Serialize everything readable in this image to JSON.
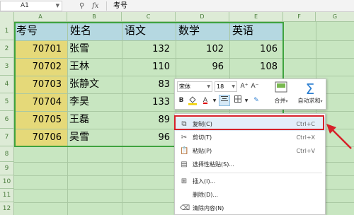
{
  "formula_bar": {
    "cell_ref": "A1",
    "fx_label": "fx",
    "content": "考号"
  },
  "columns": [
    "A",
    "B",
    "C",
    "D",
    "E",
    "F",
    "G"
  ],
  "rows": [
    "1",
    "2",
    "3",
    "4",
    "5",
    "6",
    "7",
    "8",
    "9",
    "10",
    "11",
    "12"
  ],
  "table": {
    "headers": [
      "考号",
      "姓名",
      "语文",
      "数学",
      "英语"
    ],
    "rows": [
      [
        "70701",
        "张雪",
        "132",
        "102",
        "106"
      ],
      [
        "70702",
        "王林",
        "110",
        "96",
        "108"
      ],
      [
        "70703",
        "张静文",
        "83",
        "",
        ""
      ],
      [
        "70704",
        "李昊",
        "133",
        "",
        ""
      ],
      [
        "70705",
        "王磊",
        "89",
        "",
        ""
      ],
      [
        "70706",
        "吴雪",
        "96",
        "",
        ""
      ]
    ]
  },
  "mini_toolbar": {
    "font": "宋体",
    "size": "18",
    "grow": "A⁺",
    "shrink": "A⁻",
    "bold": "B",
    "merge_label": "合并",
    "autosum_label": "自动求和"
  },
  "context_menu": {
    "items": [
      {
        "label": "复制(C)",
        "shortcut": "Ctrl+C",
        "icon": "copy-icon"
      },
      {
        "label": "剪切(T)",
        "shortcut": "Ctrl+X",
        "icon": "scissors-icon"
      },
      {
        "label": "粘贴(P)",
        "shortcut": "Ctrl+V",
        "icon": "paste-icon"
      },
      {
        "label": "选择性粘贴(S)...",
        "shortcut": "",
        "icon": "paste-special-icon"
      },
      {
        "label": "插入(I)...",
        "shortcut": "",
        "icon": "insert-icon"
      },
      {
        "label": "删除(D)...",
        "shortcut": "",
        "icon": ""
      },
      {
        "label": "清除内容(N)",
        "shortcut": "",
        "icon": "clear-icon"
      }
    ]
  },
  "colors": {
    "highlight_border": "#d6212a",
    "arrow": "#d6212a",
    "grid_bg": "#c8e6c1",
    "header_fill": "#b5d8e1",
    "id_fill": "#e5d979",
    "table_border": "#3fa33f"
  }
}
